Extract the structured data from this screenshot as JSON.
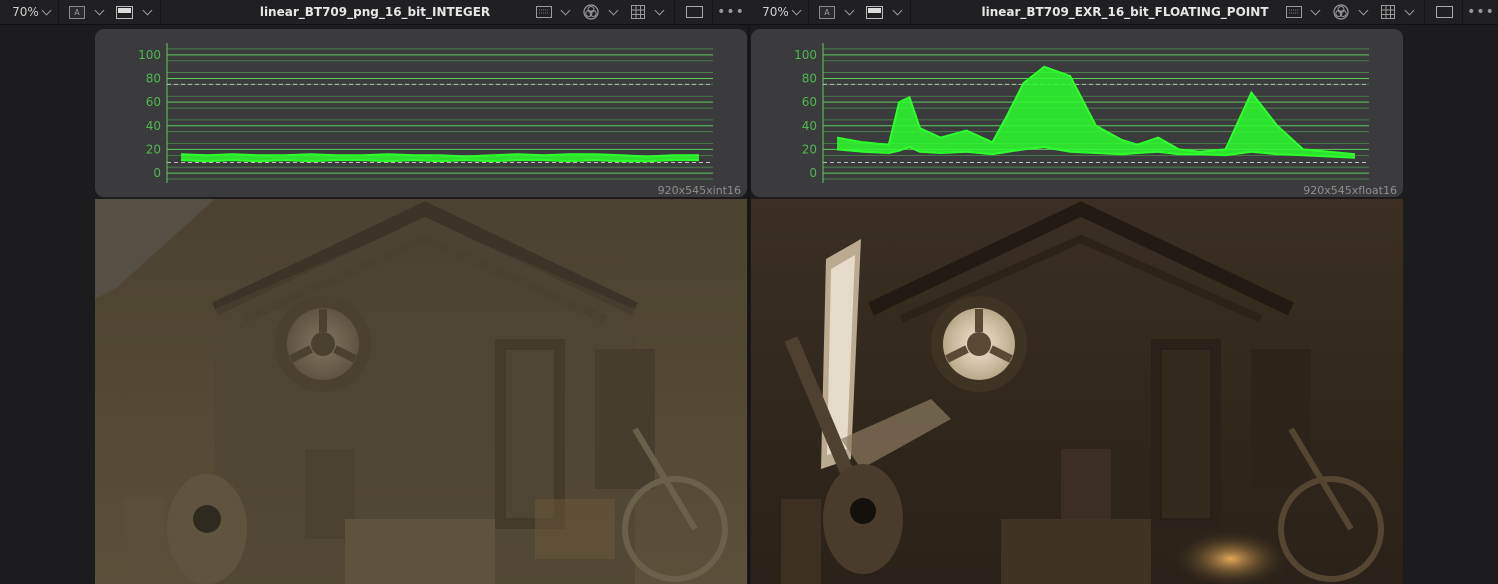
{
  "viewers": [
    {
      "zoom": "70%",
      "channel_label": "A",
      "clip_title": "linear_BT709_png_16_bit_INTEGER",
      "resolution": "920x545xint16",
      "more_label": "•••"
    },
    {
      "zoom": "70%",
      "channel_label": "A",
      "clip_title": "linear_BT709_EXR_16_bit_FLOATING_POINT",
      "resolution": "920x545xfloat16",
      "more_label": "•••"
    }
  ],
  "scope_colors": {
    "trace": "#2dff2d",
    "grid": "#5fc85f",
    "label": "#4fb84f",
    "panel": "#3b3b3d"
  },
  "chart_data": [
    {
      "type": "line",
      "ylim": [
        -5,
        110
      ],
      "yticks": [
        "100",
        "80",
        "60",
        "40",
        "20",
        "0"
      ],
      "ytick_values": [
        100,
        80,
        60,
        40,
        20,
        0
      ],
      "reference_lines": [
        75,
        9
      ],
      "x": [
        0,
        5,
        10,
        15,
        20,
        25,
        30,
        35,
        40,
        45,
        50,
        55,
        60,
        65,
        70,
        75,
        80,
        85,
        90,
        95,
        100
      ],
      "series": [
        {
          "values": [
            16,
            15,
            16,
            15,
            15,
            16,
            15,
            15,
            16,
            15,
            15,
            14,
            15,
            16,
            15,
            16,
            16,
            15,
            14,
            15,
            15
          ]
        },
        {
          "values": [
            11,
            10,
            11,
            10,
            11,
            10,
            11,
            11,
            10,
            11,
            10,
            11,
            10,
            11,
            11,
            10,
            11,
            10,
            10,
            11,
            11
          ]
        }
      ]
    },
    {
      "type": "line",
      "ylim": [
        -5,
        110
      ],
      "yticks": [
        "100",
        "80",
        "60",
        "40",
        "20",
        "0"
      ],
      "ytick_values": [
        100,
        80,
        60,
        40,
        20,
        0
      ],
      "reference_lines": [
        75,
        9
      ],
      "x": [
        0,
        5,
        10,
        12,
        14,
        16,
        20,
        25,
        30,
        33,
        36,
        40,
        45,
        50,
        55,
        58,
        62,
        66,
        70,
        75,
        80,
        85,
        90,
        95,
        100
      ],
      "series": [
        {
          "values": [
            30,
            26,
            24,
            60,
            64,
            38,
            30,
            36,
            26,
            50,
            76,
            90,
            82,
            40,
            28,
            24,
            30,
            20,
            18,
            20,
            68,
            40,
            20,
            18,
            16
          ]
        },
        {
          "values": [
            20,
            18,
            17,
            19,
            22,
            18,
            17,
            18,
            16,
            18,
            20,
            22,
            18,
            17,
            16,
            17,
            18,
            16,
            16,
            15,
            18,
            16,
            15,
            14,
            13
          ]
        }
      ]
    }
  ]
}
